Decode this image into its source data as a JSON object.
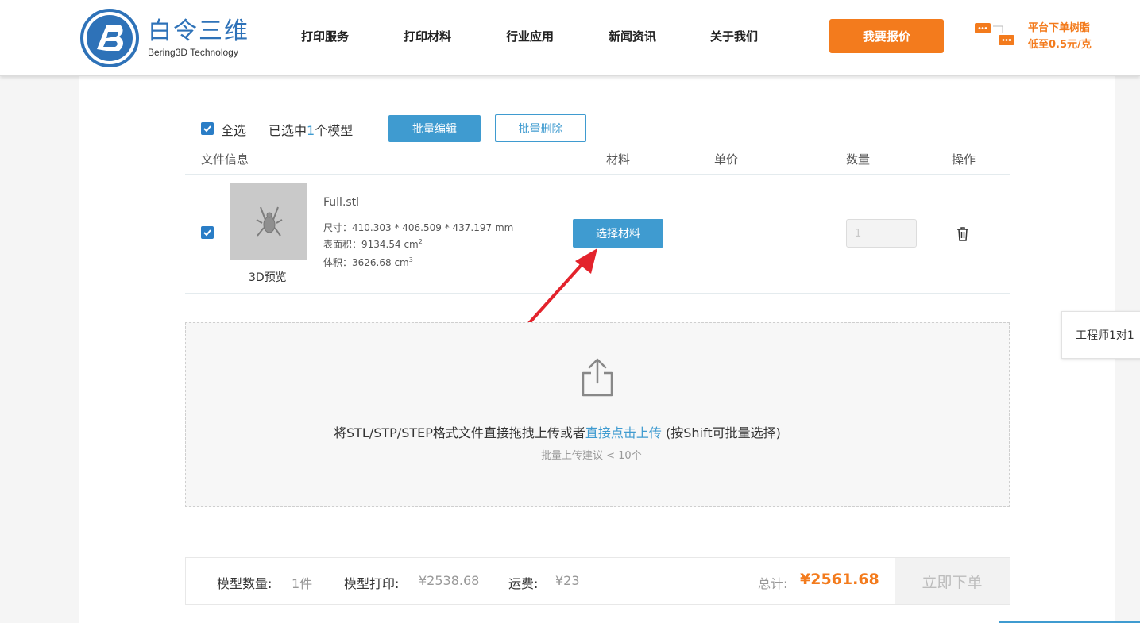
{
  "brand": {
    "name_cn": "白令三维",
    "name_en": "Bering3D Technology",
    "color": "#2e72b8"
  },
  "nav": {
    "items": [
      "打印服务",
      "打印材料",
      "行业应用",
      "新闻资讯",
      "关于我们"
    ],
    "quote_button": "我要报价",
    "promo_line1": "平台下单树脂",
    "promo_line2": "低至0.5元/克"
  },
  "toolbar": {
    "select_all_label": "全选",
    "selected_prefix": "已选中",
    "selected_count": "1",
    "selected_suffix": "个模型",
    "batch_edit": "批量编辑",
    "batch_delete": "批量删除"
  },
  "table": {
    "headers": {
      "file_info": "文件信息",
      "material": "材料",
      "unit_price": "单价",
      "quantity": "数量",
      "action": "操作"
    },
    "rows": [
      {
        "file_name": "Full.stl",
        "size_label": "尺寸：",
        "size_value": "410.303 * 406.509 * 437.197 mm",
        "area_label": "表面积：",
        "area_value": "9134.54 cm",
        "area_exp": "2",
        "volume_label": "体积：",
        "volume_value": "3626.68 cm",
        "volume_exp": "3",
        "preview_label": "3D预览",
        "select_material": "选择材料",
        "quantity": "1"
      }
    ]
  },
  "upload": {
    "text_before": "将STL/STP/STEP格式文件直接拖拽上传或者",
    "link": "直接点击上传",
    "text_after": " (按Shift可批量选择)",
    "hint": "批量上传建议 < 10个"
  },
  "summary": {
    "model_count_label": "模型数量:",
    "model_count_value": "1件",
    "print_label": "模型打印:",
    "print_value": "¥2538.68",
    "shipping_label": "运费:",
    "shipping_value": "¥23",
    "total_label": "总计:",
    "total_value": "¥2561.68",
    "order_button": "立即下单"
  },
  "side_tab": "工程师1对1",
  "colors": {
    "accent_orange": "#f37b1d",
    "accent_blue": "#3f9bd0",
    "checkbox_blue": "#2a7dc6",
    "annotation_red": "#e3232c"
  }
}
